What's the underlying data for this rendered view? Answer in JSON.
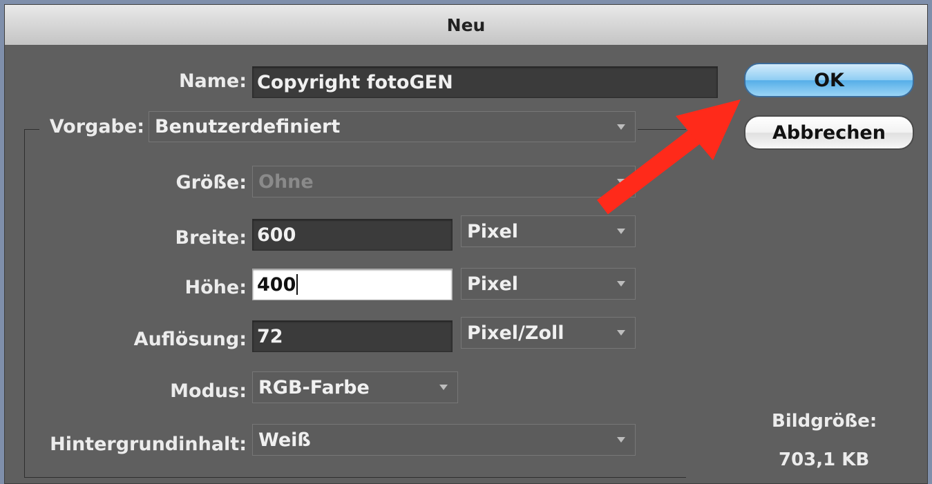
{
  "dialog": {
    "title": "Neu"
  },
  "name": {
    "label": "Name:",
    "value": "Copyright fotoGEN"
  },
  "preset": {
    "label": "Vorgabe:",
    "value": "Benutzerdefiniert"
  },
  "size": {
    "label": "Größe:",
    "value": "Ohne"
  },
  "width": {
    "label": "Breite:",
    "value": "600",
    "unit": "Pixel"
  },
  "height": {
    "label": "Höhe:",
    "value": "400",
    "unit": "Pixel"
  },
  "resolution": {
    "label": "Auflösung:",
    "value": "72",
    "unit": "Pixel/Zoll"
  },
  "mode": {
    "label": "Modus:",
    "value": "RGB-Farbe"
  },
  "background": {
    "label": "Hintergrundinhalt:",
    "value": "Weiß"
  },
  "buttons": {
    "ok": "OK",
    "cancel": "Abbrechen"
  },
  "image_size": {
    "label": "Bildgröße:",
    "value": "703,1 KB"
  },
  "annotation": {
    "color": "#ff2a1a",
    "icon": "red-pointer-arrow"
  }
}
